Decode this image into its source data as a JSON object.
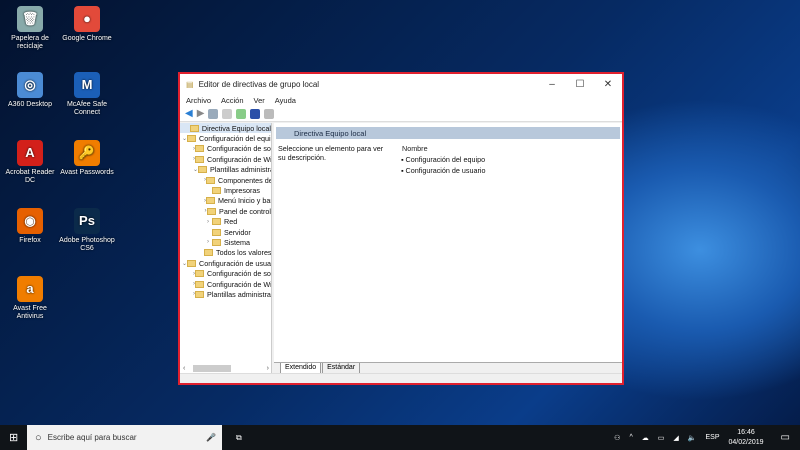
{
  "desktop": [
    {
      "label": "Papelera de reciclaje",
      "glyph": "🗑",
      "color": "#8aa"
    },
    {
      "label": "Google Chrome",
      "glyph": "●",
      "color": "#e24a3a"
    },
    {
      "label": "A360 Desktop",
      "glyph": "◎",
      "color": "#4b8bd4"
    },
    {
      "label": "McAfee Safe Connect",
      "glyph": "M",
      "color": "#1b5fb8"
    },
    {
      "label": "Acrobat Reader DC",
      "glyph": "A",
      "color": "#d3201a"
    },
    {
      "label": "Avast Passwords",
      "glyph": "🔑",
      "color": "#f07d00"
    },
    {
      "label": "Firefox",
      "glyph": "◉",
      "color": "#e66000"
    },
    {
      "label": "Adobe Photoshop CS6",
      "glyph": "Ps",
      "color": "#0b2a4a"
    },
    {
      "label": "Avast Free Antivirus",
      "glyph": "a",
      "color": "#f07d00"
    }
  ],
  "window": {
    "title": "Editor de directivas de grupo local",
    "controls": [
      "–",
      "☐",
      "✕"
    ],
    "menu": [
      "Archivo",
      "Acción",
      "Ver",
      "Ayuda"
    ],
    "tree": [
      {
        "label": "Directiva Equipo local",
        "level": 0,
        "chevron": "",
        "selected": true
      },
      {
        "label": "Configuración del equipo",
        "level": 0,
        "chevron": "⌄"
      },
      {
        "label": "Configuración de software",
        "level": 1,
        "chevron": "›"
      },
      {
        "label": "Configuración de Windows",
        "level": 1,
        "chevron": "›"
      },
      {
        "label": "Plantillas administrativas",
        "level": 1,
        "chevron": "⌄"
      },
      {
        "label": "Componentes de Windows",
        "level": 2,
        "chevron": "›"
      },
      {
        "label": "Impresoras",
        "level": 2,
        "chevron": ""
      },
      {
        "label": "Menú Inicio y barra de tareas",
        "level": 2,
        "chevron": "›"
      },
      {
        "label": "Panel de control",
        "level": 2,
        "chevron": "›"
      },
      {
        "label": "Red",
        "level": 2,
        "chevron": "›"
      },
      {
        "label": "Servidor",
        "level": 2,
        "chevron": ""
      },
      {
        "label": "Sistema",
        "level": 2,
        "chevron": "›"
      },
      {
        "label": "Todos los valores",
        "level": 2,
        "chevron": ""
      },
      {
        "label": "Configuración de usuario",
        "level": 0,
        "chevron": "⌄"
      },
      {
        "label": "Configuración de software",
        "level": 1,
        "chevron": "›"
      },
      {
        "label": "Configuración de Windows",
        "level": 1,
        "chevron": "›"
      },
      {
        "label": "Plantillas administrativas",
        "level": 1,
        "chevron": "›"
      }
    ],
    "header": "Directiva Equipo local",
    "description": "Seleccione un elemento para ver su descripción.",
    "column": "Nombre",
    "items": [
      "Configuración del equipo",
      "Configuración de usuario"
    ],
    "tabs": [
      "Extendido",
      "Estándar"
    ]
  },
  "taskbar": {
    "search_placeholder": "Escribe aquí para buscar",
    "lang": "ESP",
    "time": "16:46",
    "date": "04/02/2019"
  }
}
